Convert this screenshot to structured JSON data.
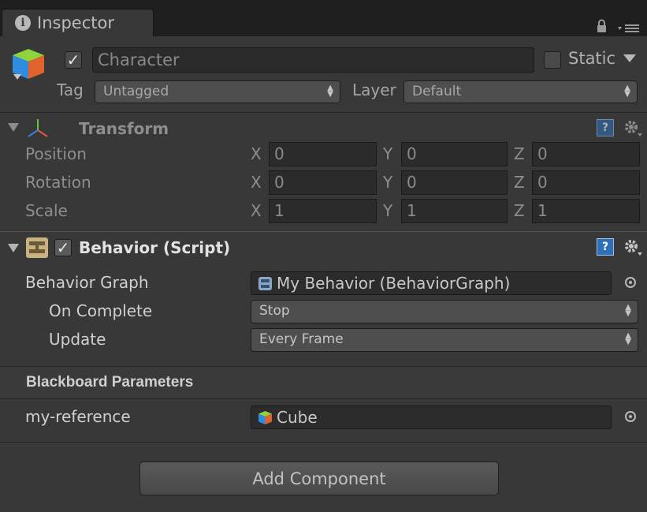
{
  "tab": {
    "label": "Inspector"
  },
  "header": {
    "name": "Character",
    "active": true,
    "static_label": "Static",
    "static": false,
    "tag_label": "Tag",
    "tag_value": "Untagged",
    "layer_label": "Layer",
    "layer_value": "Default"
  },
  "transform": {
    "title": "Transform",
    "rows": [
      {
        "label": "Position",
        "x": "0",
        "y": "0",
        "z": "0"
      },
      {
        "label": "Rotation",
        "x": "0",
        "y": "0",
        "z": "0"
      },
      {
        "label": "Scale",
        "x": "1",
        "y": "1",
        "z": "1"
      }
    ],
    "axis": {
      "x": "X",
      "y": "Y",
      "z": "Z"
    }
  },
  "behavior": {
    "title": "Behavior (Script)",
    "enabled": true,
    "graph_label": "Behavior Graph",
    "graph_value": "My Behavior (BehaviorGraph)",
    "on_complete_label": "On Complete",
    "on_complete_value": "Stop",
    "update_label": "Update",
    "update_value": "Every Frame"
  },
  "blackboard": {
    "title": "Blackboard Parameters",
    "param_label": "my-reference",
    "param_value": "Cube"
  },
  "add_component_label": "Add Component",
  "colors": {
    "panel_bg": "#383838",
    "tabbar_bg": "#1f1f1f",
    "help_blue": "#2e6fb6"
  }
}
